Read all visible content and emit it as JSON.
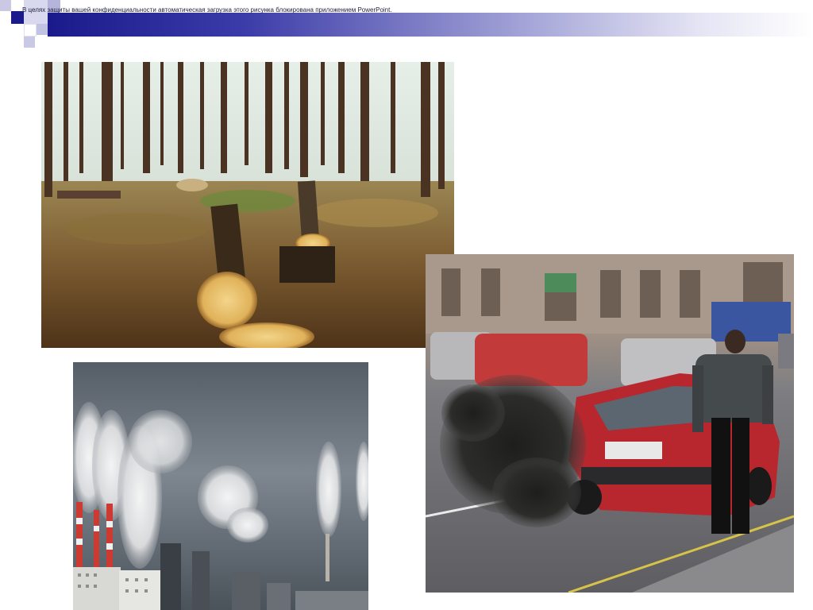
{
  "header": {
    "notice": "В целях защиты вашей конфиденциальности автоматическая загрузка этого рисунка блокирована приложением PowerPoint."
  },
  "colors": {
    "bar_dark": "#1a1a8c",
    "bar_light": "#e4e4f4"
  },
  "photos": [
    {
      "subject": "deforestation-photo"
    },
    {
      "subject": "factory-smokestacks-photo"
    },
    {
      "subject": "car-exhaust-photo"
    }
  ]
}
